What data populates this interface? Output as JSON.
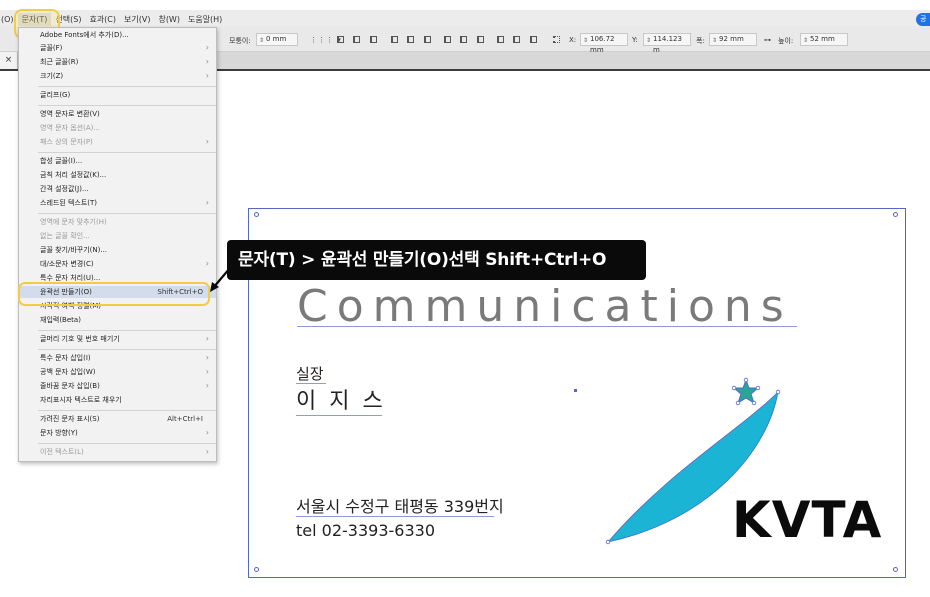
{
  "menubar": {
    "items": [
      "(O)",
      "문자(T)",
      "선택(S)",
      "효과(C)",
      "보기(V)",
      "창(W)",
      "도움말(H)"
    ],
    "share_label": "공"
  },
  "toolbar": {
    "rotate_label": "모퉁이:",
    "rotate_value": "0 mm",
    "x_label": "X:",
    "x_value": "106.72 mm",
    "y_label": "Y:",
    "y_value": "114.123 m",
    "w_label": "폭:",
    "w_value": "92 mm",
    "h_label": "높이:",
    "h_value": "52 mm"
  },
  "tab": {
    "close": "×"
  },
  "dropdown": {
    "items": [
      {
        "label": "Adobe Fonts에서 추가(D)...",
        "enabled": true
      },
      {
        "label": "글꼴(F)",
        "enabled": true,
        "submenu": true
      },
      {
        "label": "최근 글꼴(R)",
        "enabled": true,
        "submenu": true
      },
      {
        "label": "크기(Z)",
        "enabled": true,
        "submenu": true
      },
      {
        "label": "글리프(G)",
        "enabled": true
      },
      {
        "label": "영역 문자로 변환(V)",
        "enabled": true
      },
      {
        "label": "영역 문자 옵션(A)...",
        "enabled": false
      },
      {
        "label": "패스 상의 문자(P)",
        "enabled": false,
        "submenu": true
      },
      {
        "label": "합성 글꼴(I)...",
        "enabled": true
      },
      {
        "label": "금칙 처리 설정값(K)...",
        "enabled": true
      },
      {
        "label": "간격 설정값(J)...",
        "enabled": true
      },
      {
        "label": "스레드된 텍스트(T)",
        "enabled": true,
        "submenu": true
      },
      {
        "label": "영역에 문자 맞추기(H)",
        "enabled": false
      },
      {
        "label": "없는 글꼴 확인...",
        "enabled": false
      },
      {
        "label": "글꼴 찾기/바꾸기(N)...",
        "enabled": true
      },
      {
        "label": "대/소문자 변경(C)",
        "enabled": true,
        "submenu": true
      },
      {
        "label": "특수 문자 처리(U)...",
        "enabled": true
      },
      {
        "label": "윤곽선 만들기(O)",
        "enabled": true,
        "shortcut": "Shift+Ctrl+O",
        "highlighted": true
      },
      {
        "label": "시각적 여백 정렬(M)",
        "enabled": true
      },
      {
        "label": "재입력(Beta)",
        "enabled": true
      },
      {
        "label": "글머리 기호 및 번호 매기기",
        "enabled": true,
        "submenu": true
      },
      {
        "label": "특수 문자 삽입(I)",
        "enabled": true,
        "submenu": true
      },
      {
        "label": "공백 문자 삽입(W)",
        "enabled": true,
        "submenu": true
      },
      {
        "label": "줄바꿈 문자 삽입(B)",
        "enabled": true,
        "submenu": true
      },
      {
        "label": "자리표시자 텍스트로 채우기",
        "enabled": true
      },
      {
        "label": "가려진 문자 표시(S)",
        "enabled": true,
        "shortcut": "Alt+Ctrl+I"
      },
      {
        "label": "문자 방향(Y)",
        "enabled": true,
        "submenu": true
      },
      {
        "label": "이전 텍스트(L)",
        "enabled": false,
        "submenu": true
      }
    ]
  },
  "callout": {
    "text": "문자(T) > 윤곽선 만들기(O)선택 Shift+Ctrl+O"
  },
  "card": {
    "headline": "Communications",
    "title": "실장",
    "name": "이 지 스",
    "address": "서울시 수정구 태평동 339번지",
    "tel": "tel  02-3393-6330",
    "logo_text": "KVTA",
    "logo_color": "#1bb4d4"
  },
  "colors": {
    "highlight": "#f0cd45",
    "selection": "#5468c4"
  }
}
